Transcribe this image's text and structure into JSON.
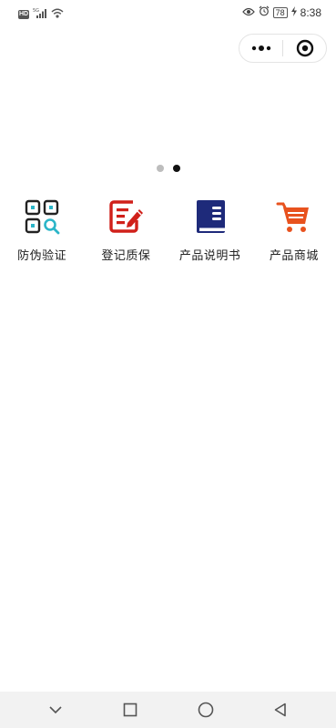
{
  "status_bar": {
    "hd_label": "HD",
    "network_label": "5G",
    "battery": "78",
    "time": "8:38"
  },
  "carousel": {
    "dot_count": 2,
    "active_index": 1
  },
  "menu": {
    "items": [
      {
        "label": "防伪验证",
        "icon": "qr-scan-icon",
        "color": "#2bb5c8"
      },
      {
        "label": "登记质保",
        "icon": "edit-note-icon",
        "color": "#d0201a"
      },
      {
        "label": "产品说明书",
        "icon": "manual-book-icon",
        "color": "#1e2a7a"
      },
      {
        "label": "产品商城",
        "icon": "shopping-cart-icon",
        "color": "#e8521e"
      }
    ]
  }
}
